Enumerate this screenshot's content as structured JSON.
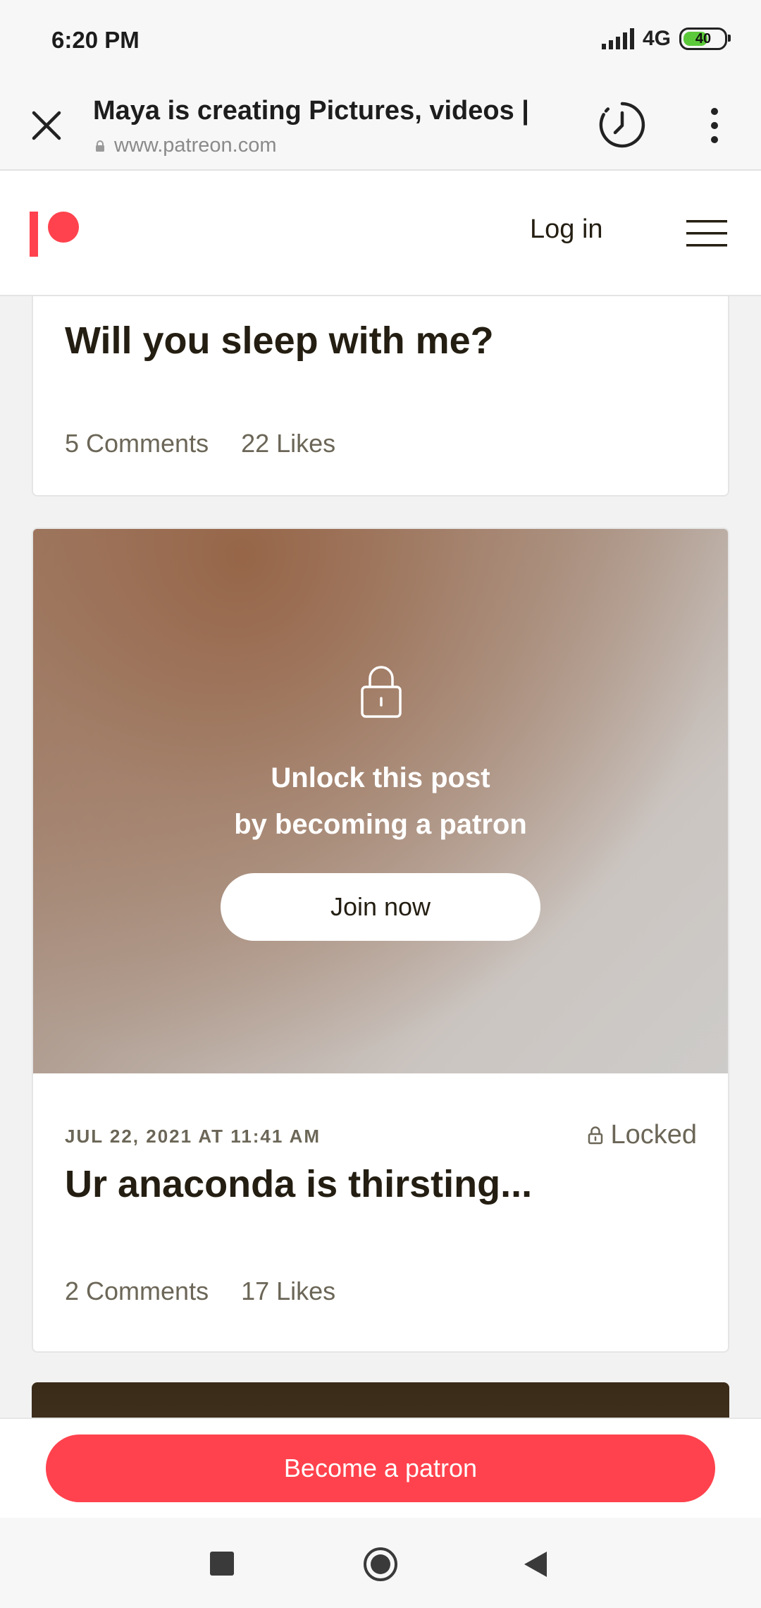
{
  "status_bar": {
    "time": "6:20 PM",
    "network": "4G",
    "battery": "40"
  },
  "browser": {
    "title": "Maya is creating Pictures, videos |",
    "url": "www.patreon.com"
  },
  "header": {
    "login_label": "Log in"
  },
  "posts": [
    {
      "title": "Will you sleep with me?",
      "comments": "5 Comments",
      "likes": "22 Likes"
    },
    {
      "unlock_line1": "Unlock this post",
      "unlock_line2": "by becoming a patron",
      "join_label": "Join now",
      "date": "JUL 22, 2021 AT 11:41 AM",
      "status": "Locked",
      "title": "Ur anaconda is thirsting...",
      "comments": "2 Comments",
      "likes": "17 Likes"
    }
  ],
  "cta": {
    "label": "Become a patron"
  },
  "colors": {
    "brand": "#ff424d",
    "text": "#241e12",
    "muted": "#6b6657"
  }
}
